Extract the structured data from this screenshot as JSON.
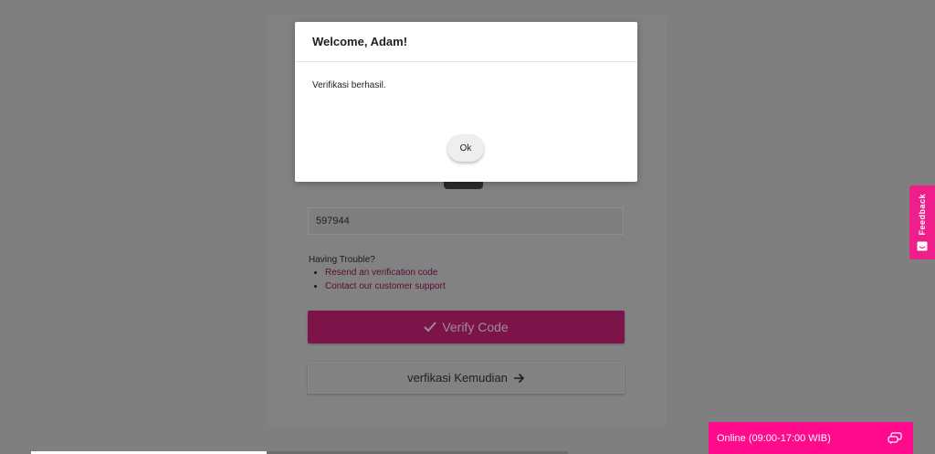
{
  "modal": {
    "title": "Welcome, Adam!",
    "message": "Verifikasi berhasil.",
    "ok_label": "Ok"
  },
  "form": {
    "code_value": "597944",
    "trouble_heading": "Having Trouble?",
    "links": [
      "Resend an verification code",
      "Contact our customer support"
    ],
    "verify_label": "Verify Code",
    "later_label": "verfikasi Kemudian"
  },
  "feedback": {
    "label": "Feedback",
    "icon": "smiley-icon"
  },
  "chat": {
    "label": "Online (09:00-17:00 WIB)",
    "icon": "chat-bubbles-icon"
  },
  "colors": {
    "overlay": "#7f7f80",
    "accent_pink": "#ff0a8d",
    "verify_button": "#7c1349",
    "link": "#5a0b33"
  }
}
